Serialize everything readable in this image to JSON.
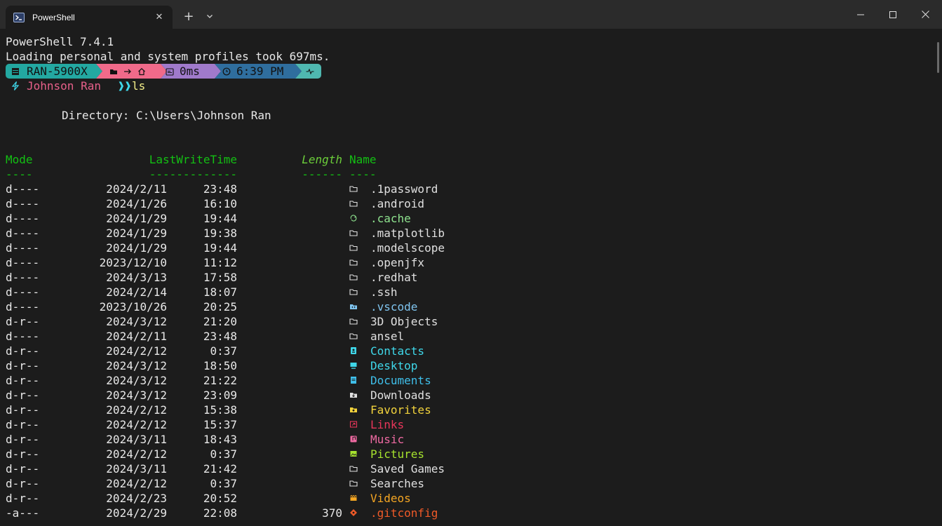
{
  "window": {
    "tab_title": "PowerShell",
    "colors": {
      "titlebar": "#2b2b2b",
      "terminal_bg": "#1c1c1c"
    }
  },
  "terminal": {
    "banner": "PowerShell 7.4.1",
    "profile_load": "Loading personal and system profiles took 697ms.",
    "prompt_bar": {
      "host": "RAN-5900X",
      "duration": "0ms",
      "time": "6:39 PM",
      "colors": {
        "host": "#23a8a1",
        "path": "#f06a8a",
        "duration": "#a07acb",
        "time": "#2f6e9e",
        "status": "#4fb8b0"
      }
    },
    "prompt": {
      "user": "Johnson Ran",
      "arrows": "❱❱",
      "command": "ls"
    },
    "directory_label": "Directory: C:\\Users\\Johnson Ran",
    "headers": {
      "mode": "Mode",
      "lastwritetime": "LastWriteTime",
      "length": "Length",
      "name": "Name"
    },
    "underlines": {
      "mode": "----",
      "lastwritetime": "-------------",
      "length": "------",
      "name": "----"
    },
    "entries": [
      {
        "mode": "d----",
        "date": "2024/2/11",
        "time": "23:48",
        "length": "",
        "icon": "folder-icon",
        "name": ".1password",
        "color": "#e0e0e0"
      },
      {
        "mode": "d----",
        "date": "2024/1/26",
        "time": "16:10",
        "length": "",
        "icon": "folder-icon",
        "name": ".android",
        "color": "#e0e0e0"
      },
      {
        "mode": "d----",
        "date": "2024/1/29",
        "time": "19:44",
        "length": "",
        "icon": "cache-icon",
        "name": ".cache",
        "color": "#8ee28e"
      },
      {
        "mode": "d----",
        "date": "2024/1/29",
        "time": "19:38",
        "length": "",
        "icon": "folder-icon",
        "name": ".matplotlib",
        "color": "#e0e0e0"
      },
      {
        "mode": "d----",
        "date": "2024/1/29",
        "time": "19:44",
        "length": "",
        "icon": "folder-icon",
        "name": ".modelscope",
        "color": "#e0e0e0"
      },
      {
        "mode": "d----",
        "date": "2023/12/10",
        "time": "11:12",
        "length": "",
        "icon": "folder-icon",
        "name": ".openjfx",
        "color": "#e0e0e0"
      },
      {
        "mode": "d----",
        "date": "2024/3/13",
        "time": "17:58",
        "length": "",
        "icon": "folder-icon",
        "name": ".redhat",
        "color": "#e0e0e0"
      },
      {
        "mode": "d----",
        "date": "2024/2/14",
        "time": "18:07",
        "length": "",
        "icon": "folder-icon",
        "name": ".ssh",
        "color": "#e0e0e0"
      },
      {
        "mode": "d----",
        "date": "2023/10/26",
        "time": "20:25",
        "length": "",
        "icon": "vscode-icon",
        "name": ".vscode",
        "color": "#7fc4ef"
      },
      {
        "mode": "d-r--",
        "date": "2024/3/12",
        "time": "21:20",
        "length": "",
        "icon": "folder-icon",
        "name": "3D Objects",
        "color": "#e0e0e0"
      },
      {
        "mode": "d----",
        "date": "2024/2/11",
        "time": "23:48",
        "length": "",
        "icon": "folder-icon",
        "name": "ansel",
        "color": "#e0e0e0"
      },
      {
        "mode": "d-r--",
        "date": "2024/2/12",
        "time": "0:37",
        "length": "",
        "icon": "contacts-icon",
        "name": "Contacts",
        "color": "#3fd8ea"
      },
      {
        "mode": "d-r--",
        "date": "2024/3/12",
        "time": "18:50",
        "length": "",
        "icon": "desktop-icon",
        "name": "Desktop",
        "color": "#3fd8ea"
      },
      {
        "mode": "d-r--",
        "date": "2024/3/12",
        "time": "21:22",
        "length": "",
        "icon": "documents-icon",
        "name": "Documents",
        "color": "#3fbfea"
      },
      {
        "mode": "d-r--",
        "date": "2024/3/12",
        "time": "23:09",
        "length": "",
        "icon": "downloads-icon",
        "name": "Downloads",
        "color": "#e0e0e0"
      },
      {
        "mode": "d-r--",
        "date": "2024/2/12",
        "time": "15:38",
        "length": "",
        "icon": "favorites-icon",
        "name": "Favorites",
        "color": "#f2d33c"
      },
      {
        "mode": "d-r--",
        "date": "2024/2/12",
        "time": "15:37",
        "length": "",
        "icon": "links-icon",
        "name": "Links",
        "color": "#e8365a"
      },
      {
        "mode": "d-r--",
        "date": "2024/3/11",
        "time": "18:43",
        "length": "",
        "icon": "music-icon",
        "name": "Music",
        "color": "#ef6aa2"
      },
      {
        "mode": "d-r--",
        "date": "2024/2/12",
        "time": "0:37",
        "length": "",
        "icon": "pictures-icon",
        "name": "Pictures",
        "color": "#a6e22e"
      },
      {
        "mode": "d-r--",
        "date": "2024/3/11",
        "time": "21:42",
        "length": "",
        "icon": "folder-icon",
        "name": "Saved Games",
        "color": "#e0e0e0"
      },
      {
        "mode": "d-r--",
        "date": "2024/2/12",
        "time": "0:37",
        "length": "",
        "icon": "folder-icon",
        "name": "Searches",
        "color": "#e0e0e0"
      },
      {
        "mode": "d-r--",
        "date": "2024/2/23",
        "time": "20:52",
        "length": "",
        "icon": "videos-icon",
        "name": "Videos",
        "color": "#f5a623"
      },
      {
        "mode": "-a---",
        "date": "2024/2/29",
        "time": "22:08",
        "length": "370",
        "icon": "git-icon",
        "name": ".gitconfig",
        "color": "#f05a28"
      }
    ],
    "colors": {
      "text": "#e8e8e8",
      "header": "#13c013",
      "length_header": "#6ccf3a",
      "user": "#e8608a",
      "command": "#f5f08a",
      "arrows": "#3fd8ea"
    }
  }
}
